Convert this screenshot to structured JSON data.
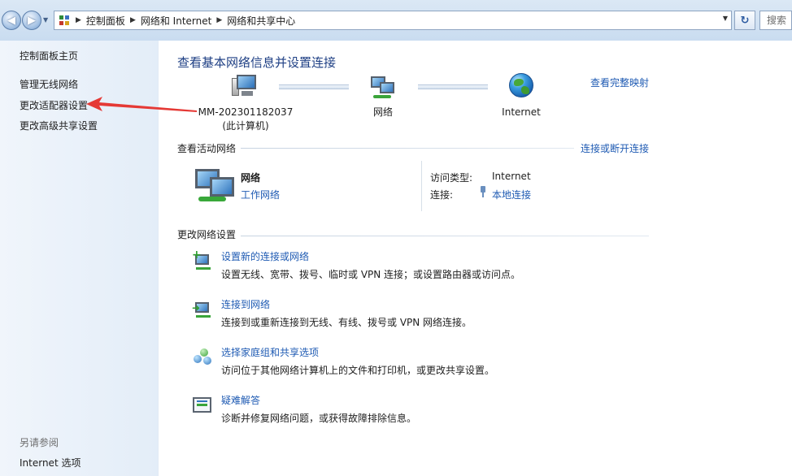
{
  "topbar": {
    "breadcrumbs": [
      "控制面板",
      "网络和 Internet",
      "网络和共享中心"
    ],
    "search_placeholder": "搜索"
  },
  "left_pane": {
    "home": "控制面板主页",
    "links": [
      "管理无线网络",
      "更改适配器设置",
      "更改高级共享设置"
    ],
    "see_also_label": "另请参阅",
    "see_also_links": [
      "Internet 选项"
    ]
  },
  "main": {
    "title": "查看基本网络信息并设置连接",
    "full_map_link": "查看完整映射",
    "map": {
      "computer_name": "MM-202301182037",
      "computer_sub": "(此计算机)",
      "network_label": "网络",
      "internet_label": "Internet"
    },
    "active_section": {
      "title": "查看活动网络",
      "connect_link": "连接或断开连接",
      "network_name": "网络",
      "network_type": "工作网络",
      "access_type_label": "访问类型:",
      "access_type_value": "Internet",
      "connection_label": "连接:",
      "connection_value": "本地连接"
    },
    "change_section": {
      "title": "更改网络设置",
      "tasks": [
        {
          "title": "设置新的连接或网络",
          "desc": "设置无线、宽带、拨号、临时或 VPN 连接；或设置路由器或访问点。"
        },
        {
          "title": "连接到网络",
          "desc": "连接到或重新连接到无线、有线、拨号或 VPN 网络连接。"
        },
        {
          "title": "选择家庭组和共享选项",
          "desc": "访问位于其他网络计算机上的文件和打印机，或更改共享设置。"
        },
        {
          "title": "疑难解答",
          "desc": "诊断并修复网络问题，或获得故障排除信息。"
        }
      ]
    }
  }
}
